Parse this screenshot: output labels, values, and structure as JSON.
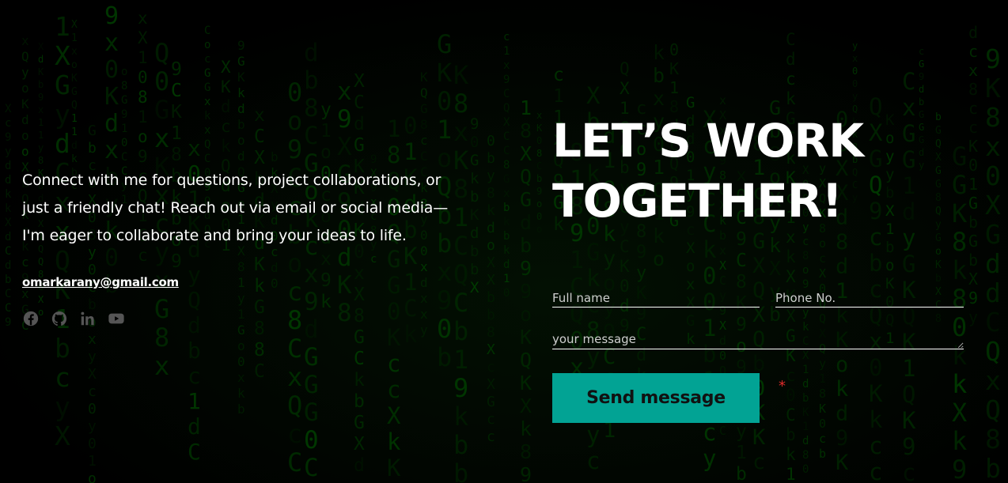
{
  "contact": {
    "intro": "Connect with me for questions, project collaborations, or just a friendly chat! Reach out via email or social media—I'm eager to collaborate and bring your ideas to life.",
    "email": "omarkarany@gmail.com",
    "socials": [
      {
        "name": "Facebook",
        "icon": "facebook-icon"
      },
      {
        "name": "GitHub",
        "icon": "github-icon"
      },
      {
        "name": "LinkedIn",
        "icon": "linkedin-icon"
      },
      {
        "name": "YouTube",
        "icon": "youtube-icon"
      }
    ]
  },
  "heading": {
    "line1": "LET’S WORK",
    "line2": "TOGETHER!"
  },
  "form": {
    "full_name_placeholder": "Full name",
    "phone_placeholder": "Phone No.",
    "message_placeholder": "your message",
    "send_label": "Send message",
    "required_mark": "*"
  },
  "colors": {
    "background": "#000000",
    "matrix_green": "#0b3d0b",
    "button": "#02a394",
    "required": "#e02b2b",
    "icon_gray": "#555555"
  }
}
